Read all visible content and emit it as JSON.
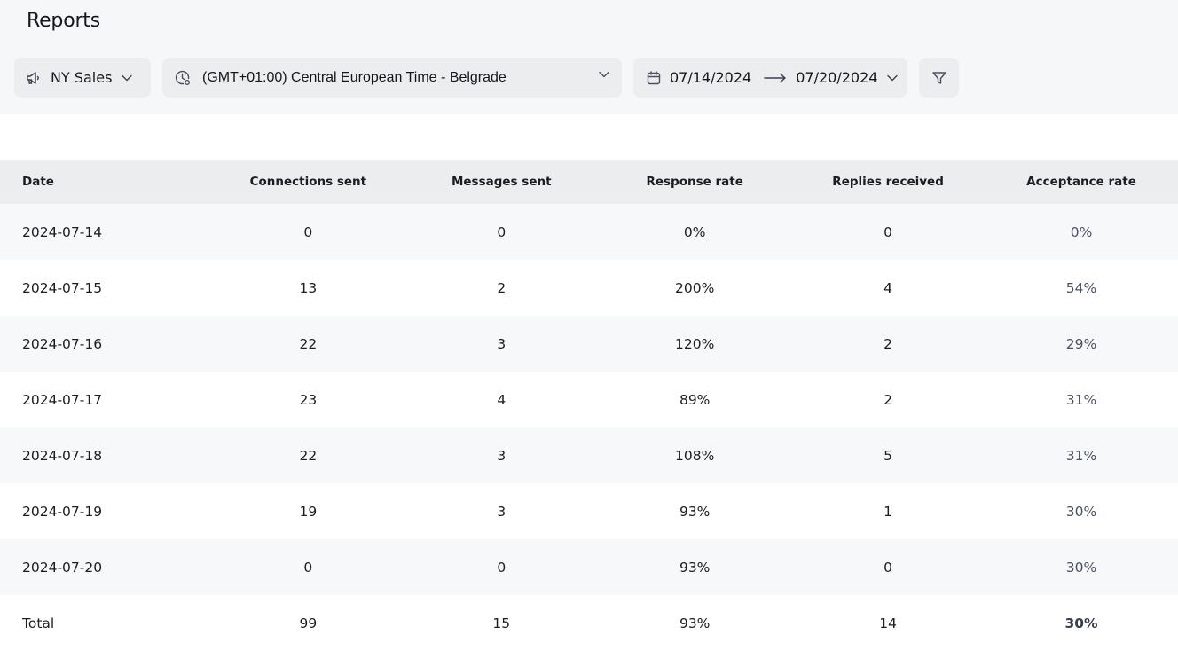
{
  "header": {
    "title": "Reports"
  },
  "filters": {
    "campaign": {
      "icon": "megaphone-icon",
      "value": "NY Sales"
    },
    "timezone": {
      "icon": "clock-icon",
      "value": "(GMT+01:00) Central European Time - Belgrade"
    },
    "date_range": {
      "icon": "calendar-icon",
      "start": "07/14/2024",
      "end": "07/20/2024"
    },
    "filter_button": {
      "icon": "filter-icon"
    }
  },
  "table": {
    "columns": [
      "Date",
      "Connections sent",
      "Messages sent",
      "Response rate",
      "Replies received",
      "Acceptance rate"
    ],
    "rows": [
      [
        "2024-07-14",
        "0",
        "0",
        "0%",
        "0",
        "0%"
      ],
      [
        "2024-07-15",
        "13",
        "2",
        "200%",
        "4",
        "54%"
      ],
      [
        "2024-07-16",
        "22",
        "3",
        "120%",
        "2",
        "29%"
      ],
      [
        "2024-07-17",
        "23",
        "4",
        "89%",
        "2",
        "31%"
      ],
      [
        "2024-07-18",
        "22",
        "3",
        "108%",
        "5",
        "31%"
      ],
      [
        "2024-07-19",
        "19",
        "3",
        "93%",
        "1",
        "30%"
      ],
      [
        "2024-07-20",
        "0",
        "0",
        "93%",
        "0",
        "30%"
      ]
    ],
    "total": [
      "Total",
      "99",
      "15",
      "93%",
      "14",
      "30%"
    ]
  },
  "colors": {
    "top_background": "#f6f7f8",
    "header_background": "#ecedef",
    "row_alt_background": "#f7f8f9",
    "acceptance_text": "#4a5060"
  }
}
